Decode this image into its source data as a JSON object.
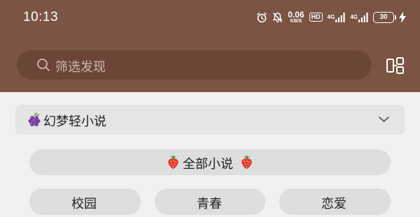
{
  "status_bar": {
    "time": "10:13",
    "net_speed_value": "0.06",
    "net_speed_unit": "KB/S",
    "hd_badge": "HD",
    "signal_1_label": "4G",
    "signal_2_label": "4G",
    "battery": "30",
    "icons": [
      "alarm-icon",
      "mute-bell-icon",
      "signal-icon",
      "signal-icon",
      "battery-icon",
      "charging-icon"
    ]
  },
  "search": {
    "placeholder": "筛选发现",
    "icon": "search-icon"
  },
  "header": {
    "layout_icon": "layout-icon",
    "background_color": "#7b5444"
  },
  "category": {
    "icon": "grape-icon",
    "label": "幻梦轻小说",
    "chevron": "chevron-down-icon"
  },
  "filters": {
    "all_label": "全部小说",
    "all_icons": [
      "strawberry-icon",
      "strawberry-icon"
    ],
    "tags": [
      "校园",
      "青春",
      "恋爱"
    ]
  }
}
